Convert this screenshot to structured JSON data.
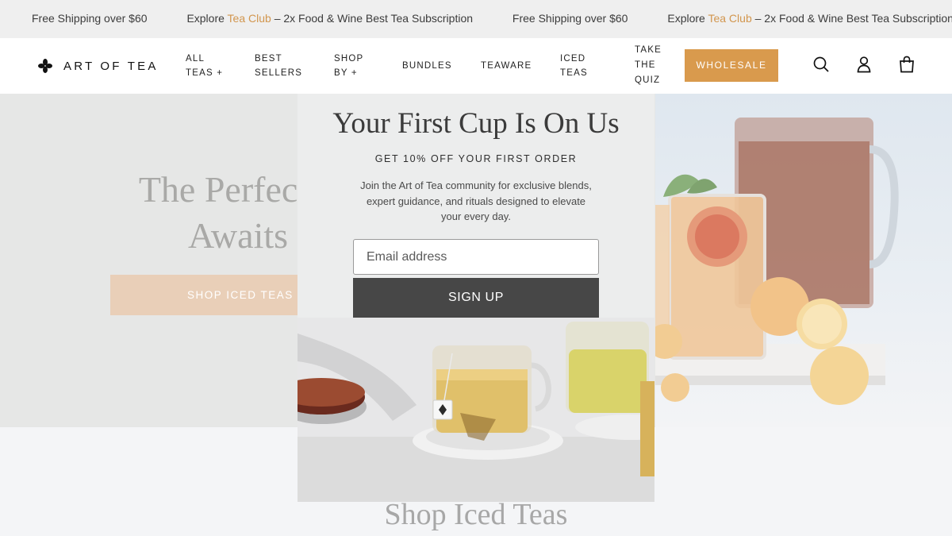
{
  "announcement": {
    "items": [
      {
        "text": "Free Shipping over $60"
      },
      {
        "prefix": "Explore ",
        "accent": "Tea Club",
        "suffix": " – 2x Food & Wine Best Tea Subscription"
      },
      {
        "text": "Free Shipping over $60"
      },
      {
        "prefix": "Explore ",
        "accent": "Tea Club",
        "suffix": " – 2x Food & Wine Best Tea Subscription"
      }
    ]
  },
  "header": {
    "logo_text": "ART OF TEA",
    "nav": [
      {
        "line1": "ALL",
        "line2": "TEAS +"
      },
      {
        "line1": "BEST",
        "line2": "SELLERS"
      },
      {
        "line1": "SHOP",
        "line2": "BY +"
      },
      {
        "line1": "BUNDLES"
      },
      {
        "line1": "TEAWARE"
      },
      {
        "line1": "ICED",
        "line2": "TEAS"
      },
      {
        "line1": "TAKE",
        "line2": "THE",
        "line3": "QUIZ"
      }
    ],
    "wholesale_label": "WHOLESALE",
    "icons": [
      "search-icon",
      "account-icon",
      "cart-icon"
    ]
  },
  "hero": {
    "title_line1": "The Perfect P",
    "title_line2": "Awaits",
    "cta_label": "SHOP ICED TEAS"
  },
  "section": {
    "title": "Shop Iced Teas"
  },
  "modal": {
    "title": "Your First Cup Is On Us",
    "subtitle": "GET 10% OFF YOUR FIRST ORDER",
    "body": "Join the Art of Tea community for exclusive blends, expert guidance, and rituals designed to elevate your every day.",
    "email_placeholder": "Email address",
    "signup_label": "SIGN UP"
  },
  "colors": {
    "accent": "#d99a4d",
    "announcement_bg": "#efefef",
    "signup_bg": "#474747",
    "hero_cta_bg": "#e9cfb8"
  }
}
